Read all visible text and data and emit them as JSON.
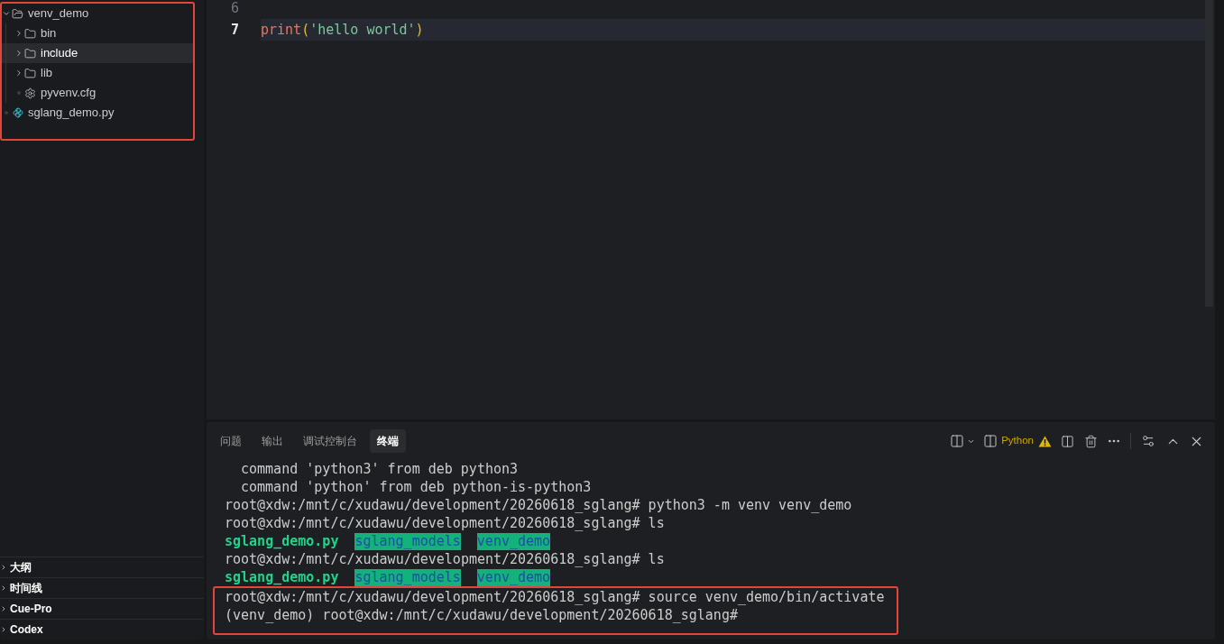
{
  "explorer": {
    "highlighted": true,
    "tree": [
      {
        "name": "venv_demo",
        "kind": "folder",
        "expanded": true,
        "selected": false,
        "children": [
          {
            "name": "bin",
            "kind": "folder",
            "expanded": false,
            "selected": false
          },
          {
            "name": "include",
            "kind": "folder",
            "expanded": false,
            "selected": true
          },
          {
            "name": "lib",
            "kind": "folder",
            "expanded": false,
            "selected": false
          },
          {
            "name": "pyvenv.cfg",
            "kind": "config",
            "selected": false
          }
        ]
      },
      {
        "name": "sglang_demo.py",
        "kind": "python",
        "selected": false
      }
    ]
  },
  "sidebar_sections": [
    {
      "label": "大纲",
      "expanded": false
    },
    {
      "label": "时间线",
      "expanded": false
    },
    {
      "label": "Cue-Pro",
      "expanded": false
    },
    {
      "label": "Codex",
      "expanded": false
    }
  ],
  "editor": {
    "lines": [
      {
        "number": "6",
        "current": false
      },
      {
        "number": "7",
        "current": true,
        "tokens": [
          {
            "kind": "function",
            "text": "print"
          },
          {
            "kind": "bracket",
            "text": "("
          },
          {
            "kind": "string",
            "text": "'hello world'"
          },
          {
            "kind": "bracket",
            "text": ")"
          }
        ]
      }
    ]
  },
  "panel": {
    "tabs": [
      {
        "label": "问题",
        "selected": false
      },
      {
        "label": "输出",
        "selected": false
      },
      {
        "label": "调试控制台",
        "selected": false
      },
      {
        "label": "终端",
        "selected": true
      }
    ],
    "terminal_profile": {
      "label": "Python",
      "warning": true
    },
    "terminal": {
      "blocks": [
        {
          "highlighted": false,
          "lines": [
            {
              "kind": "indented",
              "text": "command 'python3' from deb python3"
            },
            {
              "kind": "indented",
              "text": "command 'python' from deb python-is-python3"
            },
            {
              "kind": "text",
              "text": "root@xdw:/mnt/c/xudawu/development/20260618_sglang# python3 -m venv venv_demo"
            },
            {
              "kind": "text",
              "text": "root@xdw:/mnt/c/xudawu/development/20260618_sglang# ls"
            },
            {
              "kind": "listing",
              "entries": [
                {
                  "kind": "executable",
                  "text": "sglang_demo.py"
                },
                {
                  "kind": "directory",
                  "text": "sglang_models"
                },
                {
                  "kind": "directory",
                  "text": "venv_demo"
                }
              ]
            },
            {
              "kind": "text",
              "text": "root@xdw:/mnt/c/xudawu/development/20260618_sglang# ls"
            },
            {
              "kind": "listing",
              "entries": [
                {
                  "kind": "executable",
                  "text": "sglang_demo.py"
                },
                {
                  "kind": "directory",
                  "text": "sglang_models"
                },
                {
                  "kind": "directory",
                  "text": "venv_demo"
                }
              ]
            }
          ]
        },
        {
          "highlighted": true,
          "lines": [
            {
              "kind": "text",
              "text": "root@xdw:/mnt/c/xudawu/development/20260618_sglang# source venv_demo/bin/activate"
            },
            {
              "kind": "text",
              "text": "(venv_demo) root@xdw:/mnt/c/xudawu/development/20260618_sglang#"
            }
          ]
        }
      ]
    }
  }
}
